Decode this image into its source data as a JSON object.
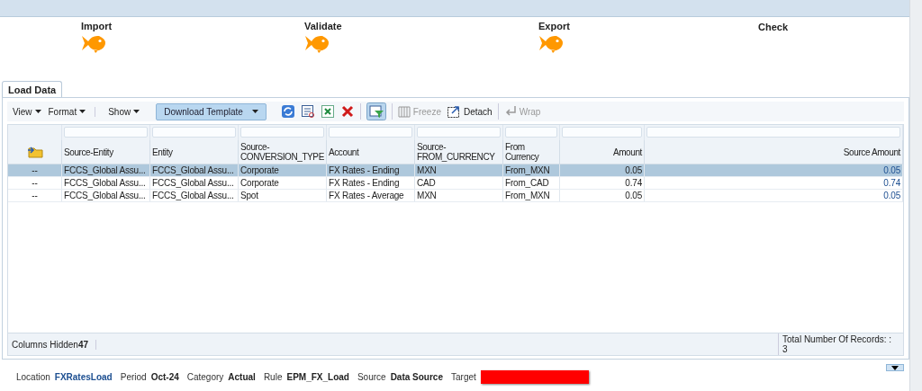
{
  "steps": [
    {
      "label": "Import",
      "done": true
    },
    {
      "label": "Validate",
      "done": true
    },
    {
      "label": "Export",
      "done": true
    },
    {
      "label": "Check",
      "done": false
    }
  ],
  "tabs": [
    {
      "label": "Load Data",
      "selected": true
    }
  ],
  "toolbar": {
    "menus": [
      "View",
      "Format",
      "Show"
    ],
    "download_button": "Download Template",
    "freeze": {
      "label": "Freeze",
      "disabled": true
    },
    "detach": {
      "label": "Detach",
      "disabled": false
    },
    "wrap": {
      "label": "Wrap",
      "disabled": true
    }
  },
  "table": {
    "columns": [
      {
        "kind": "icon"
      },
      {
        "label": "Source-Entity"
      },
      {
        "label": "Entity"
      },
      {
        "label": "Source-CONVERSION_TYPE"
      },
      {
        "label": "Account"
      },
      {
        "label": "Source-FROM_CURRENCY"
      },
      {
        "label": "From Currency"
      },
      {
        "label": "Amount"
      },
      {
        "label": "Source Amount"
      }
    ],
    "rows": [
      {
        "selected": true,
        "cells": [
          "--",
          "FCCS_Global Assu...",
          "FCCS_Global Assu...",
          "Corporate",
          "FX Rates - Ending",
          "MXN",
          "From_MXN",
          "0.05",
          "0.05"
        ]
      },
      {
        "selected": false,
        "cells": [
          "--",
          "FCCS_Global Assu...",
          "FCCS_Global Assu...",
          "Corporate",
          "FX Rates - Ending",
          "CAD",
          "From_CAD",
          "0.74",
          "0.74"
        ]
      },
      {
        "selected": false,
        "cells": [
          "--",
          "FCCS_Global Assu...",
          "FCCS_Global Assu...",
          "Spot",
          "FX Rates - Average",
          "MXN",
          "From_MXN",
          "0.05",
          "0.05"
        ]
      }
    ]
  },
  "footer": {
    "columns_hidden_label": "Columns Hidden",
    "columns_hidden_count": "47",
    "total_label": "Total Number Of Records: :",
    "total_count": "3"
  },
  "info": [
    {
      "label": "Location",
      "value": "FXRatesLoad",
      "kind": "link"
    },
    {
      "label": "Period",
      "value": "Oct-24",
      "kind": "text"
    },
    {
      "label": "Category",
      "value": "Actual",
      "kind": "text"
    },
    {
      "label": "Rule",
      "value": "EPM_FX_Load",
      "kind": "text"
    },
    {
      "label": "Source",
      "value": "Data Source",
      "kind": "text"
    },
    {
      "label": "Target",
      "kind": "redacted"
    }
  ]
}
